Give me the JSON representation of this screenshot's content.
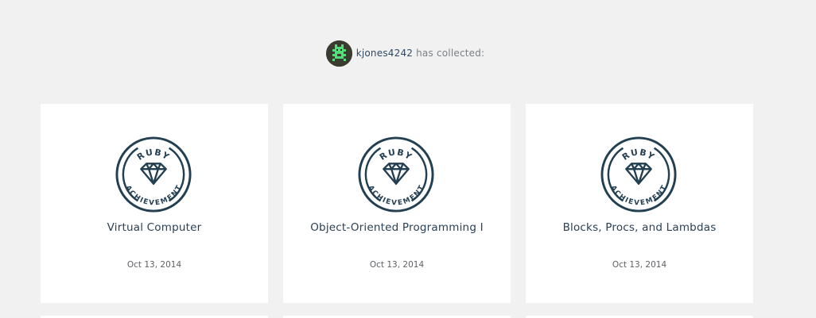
{
  "profile": {
    "username": "kjones4242",
    "suffix": "has collected:",
    "avatar_icon": "pixel-robot-avatar"
  },
  "colors": {
    "background": "#f0f1f0",
    "card": "#ffffff",
    "badge_stroke": "#233f52",
    "title_text": "#2a4054",
    "link": "#2f4a64",
    "muted_text": "#7c8085"
  },
  "achievements": [
    {
      "badge_top": "RUBY",
      "badge_bottom": "ACHIEVEMENT",
      "badge_icon": "gem-icon",
      "title": "Virtual Computer",
      "date": "Oct 13, 2014"
    },
    {
      "badge_top": "RUBY",
      "badge_bottom": "ACHIEVEMENT",
      "badge_icon": "gem-icon",
      "title": "Object-Oriented Programming I",
      "date": "Oct 13, 2014"
    },
    {
      "badge_top": "RUBY",
      "badge_bottom": "ACHIEVEMENT",
      "badge_icon": "gem-icon",
      "title": "Blocks, Procs, and Lambdas",
      "date": "Oct 13, 2014"
    }
  ]
}
